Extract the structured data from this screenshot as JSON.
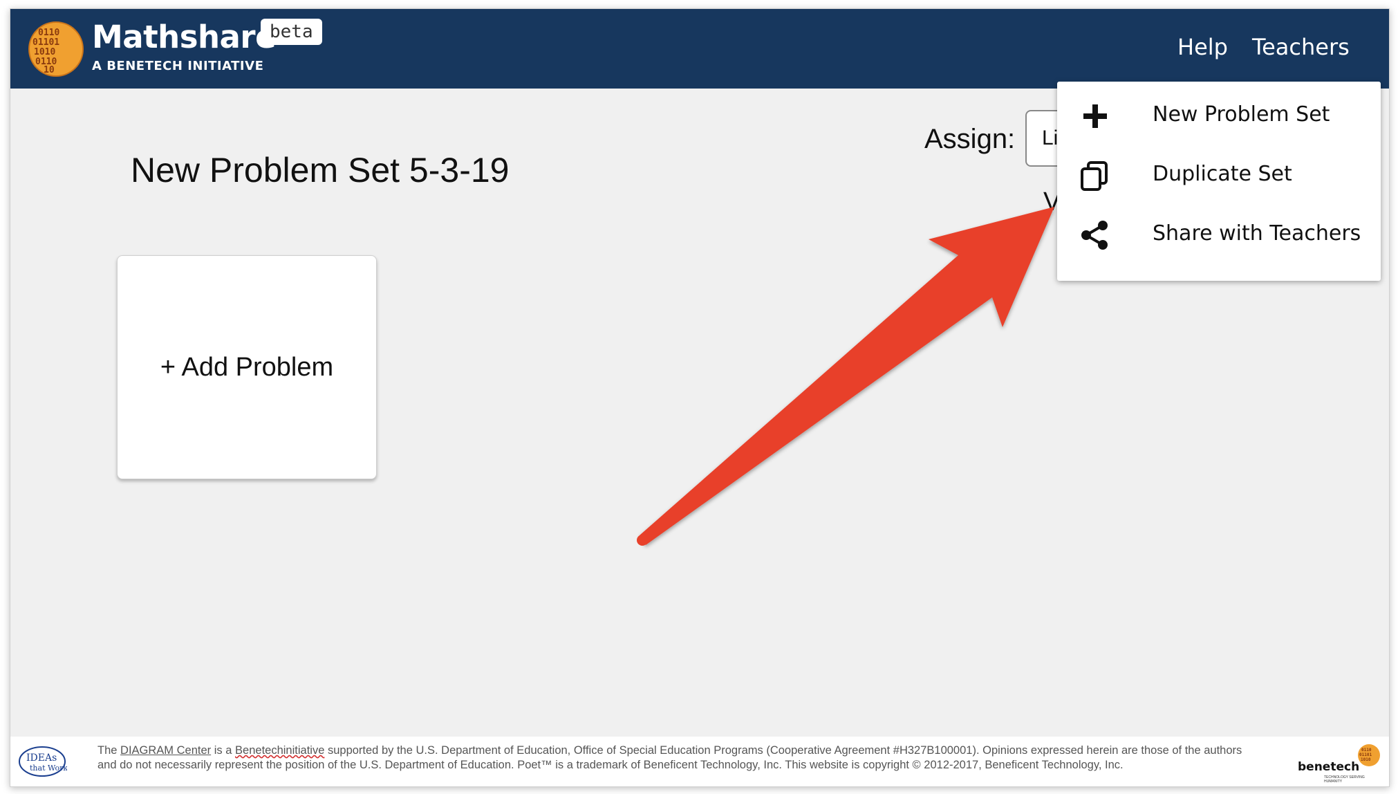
{
  "header": {
    "brand": "Mathshare",
    "subtitle": "A BENETECH INITIATIVE",
    "badge": "beta",
    "nav": [
      "Help",
      "Teachers"
    ]
  },
  "main": {
    "problem_set_title": "New Problem Set 5-3-19",
    "add_problem_label": "+ Add Problem",
    "assign_label": "Assign:",
    "assign_value_visible": "Li",
    "partially_hidden_text": "V"
  },
  "menu": {
    "items": [
      {
        "label": "New Problem Set",
        "icon": "plus-icon"
      },
      {
        "label": "Duplicate Set",
        "icon": "copy-icon"
      },
      {
        "label": "Share with Teachers",
        "icon": "share-icon"
      }
    ]
  },
  "footer": {
    "ideas_logo_line1": "IDEAs",
    "ideas_logo_line2": "that Work",
    "t_1": "The",
    "diagram_link": "DIAGRAM Center",
    "t_2": "is a",
    "benetech_word": "Benetechinitiative",
    "t_3": "supported by the U.S. Department of Education, Office of Special Education Programs (Cooperative Agreement #H327B100001). Opinions expressed herein are those of the authors and do not necessarily represent the position of the U.S. Department of Education. Poet™ is a trademark of Beneficent Technology, Inc. This website is copyright © 2012-2017, Beneficent Technology, Inc.",
    "benetech_logo_word": "benetech",
    "benetech_logo_tagline": "TECHNOLOGY SERVING HUMANITY"
  },
  "colors": {
    "navbar_bg": "#17375e",
    "annotation_arrow": "#e8412a",
    "logo_orange": "#f0a030"
  }
}
